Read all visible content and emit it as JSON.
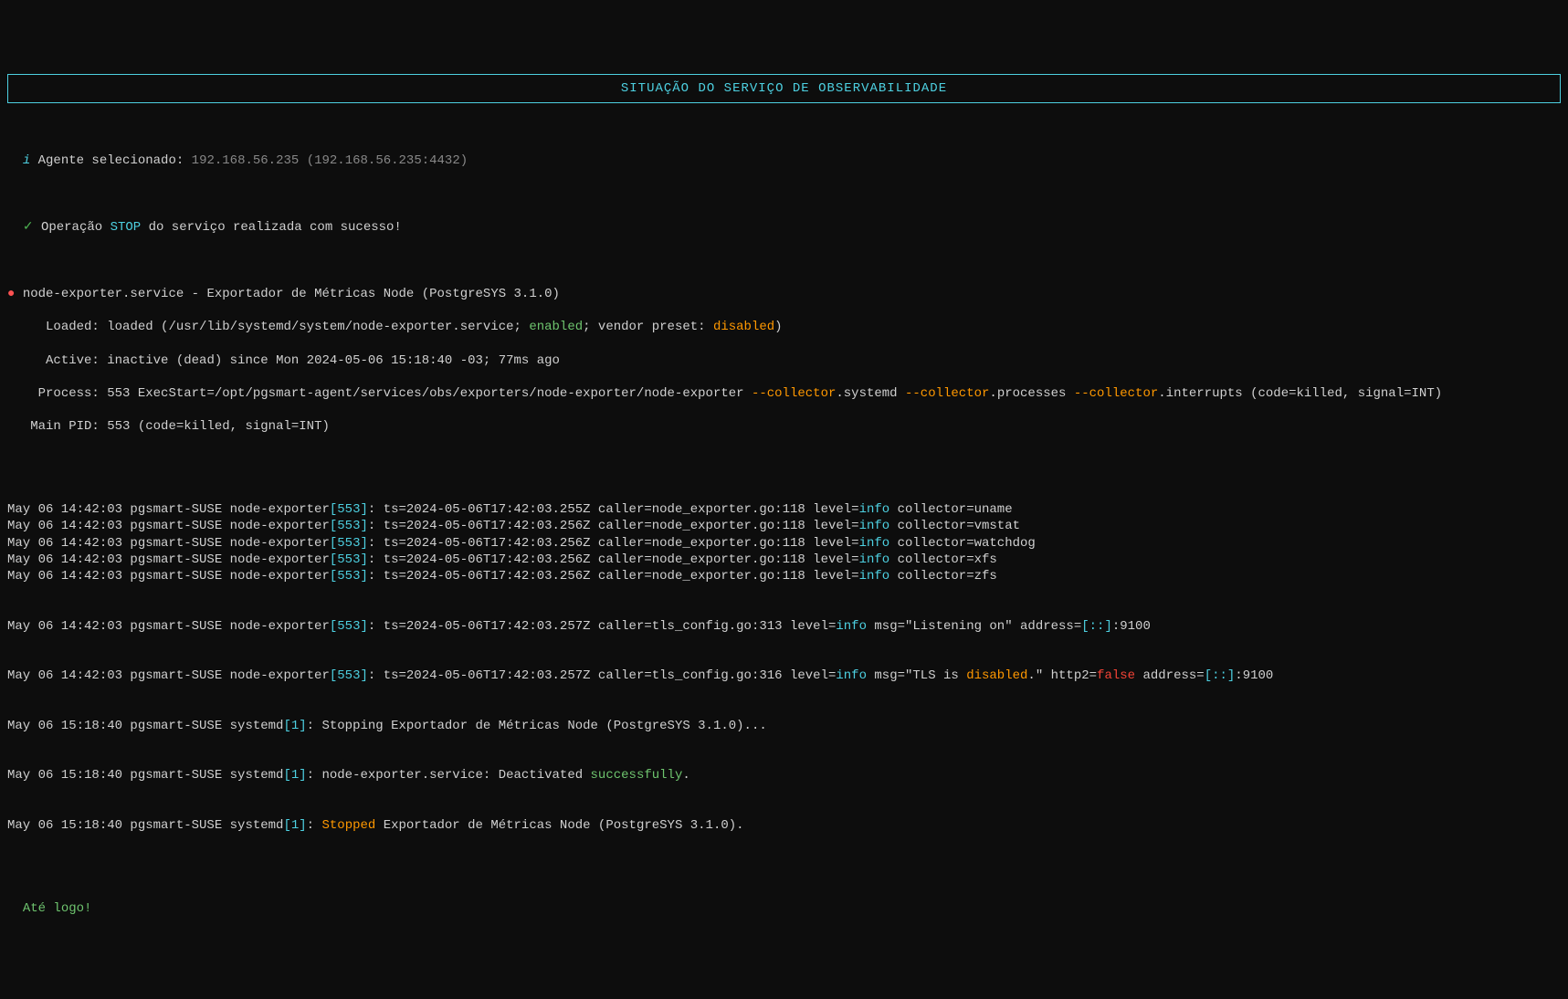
{
  "header": {
    "title": "SITUAÇÃO DO SERVIÇO DE OBSERVABILIDADE"
  },
  "agent": {
    "label": "Agente selecionado:",
    "ip": "192.168.56.235",
    "addr": "(192.168.56.235:4432)"
  },
  "operation": {
    "prefix": "Operação ",
    "action": "STOP",
    "suffix": " do serviço realizada com sucesso!"
  },
  "service": {
    "name": "node-exporter.service",
    "desc": "Exportador de Métricas Node (PostgreSYS 3.1.0)",
    "loaded_label": "Loaded:",
    "loaded_text1": "loaded (/usr/lib/systemd/system/node-exporter.service; ",
    "enabled": "enabled",
    "loaded_text2": "; vendor preset: ",
    "disabled_preset": "disabled",
    "loaded_text3": ")",
    "active_label": "Active:",
    "active_text": "inactive (dead) since Mon 2024-05-06 15:18:40 -03; 77ms ago",
    "process_label": "Process:",
    "process_text1": "553 ExecStart=/opt/pgsmart-agent/services/obs/exporters/node-exporter/node-exporter ",
    "collector_flag1": "--collector",
    "collector_val1": ".systemd ",
    "collector_flag2": "--collector",
    "collector_val2": ".processes ",
    "collector_flag3": "--collector",
    "collector_val3": ".interrupts (code=killed, signal=INT)",
    "mainpid_label": "Main PID:",
    "mainpid_text": "553 (code=killed, signal=INT)"
  },
  "logs": [
    {
      "ts": "May 06 14:42:03 pgsmart-SUSE node-exporter",
      "pid": "553",
      "body1": ": ts=2024-05-06T17:42:03.255Z caller=node_exporter.go:118 level=",
      "level": "info",
      "body2": " collector=uname"
    },
    {
      "ts": "May 06 14:42:03 pgsmart-SUSE node-exporter",
      "pid": "553",
      "body1": ": ts=2024-05-06T17:42:03.256Z caller=node_exporter.go:118 level=",
      "level": "info",
      "body2": " collector=vmstat"
    },
    {
      "ts": "May 06 14:42:03 pgsmart-SUSE node-exporter",
      "pid": "553",
      "body1": ": ts=2024-05-06T17:42:03.256Z caller=node_exporter.go:118 level=",
      "level": "info",
      "body2": " collector=watchdog"
    },
    {
      "ts": "May 06 14:42:03 pgsmart-SUSE node-exporter",
      "pid": "553",
      "body1": ": ts=2024-05-06T17:42:03.256Z caller=node_exporter.go:118 level=",
      "level": "info",
      "body2": " collector=xfs"
    },
    {
      "ts": "May 06 14:42:03 pgsmart-SUSE node-exporter",
      "pid": "553",
      "body1": ": ts=2024-05-06T17:42:03.256Z caller=node_exporter.go:118 level=",
      "level": "info",
      "body2": " collector=zfs"
    }
  ],
  "log_listen": {
    "ts": "May 06 14:42:03 pgsmart-SUSE node-exporter",
    "pid": "553",
    "body1": ": ts=2024-05-06T17:42:03.257Z caller=tls_config.go:313 level=",
    "level": "info",
    "body2": " msg=\"Listening on\" address=",
    "addr": "[::]",
    "port": ":9100"
  },
  "log_tls": {
    "ts": "May 06 14:42:03 pgsmart-SUSE node-exporter",
    "pid": "553",
    "body1": ": ts=2024-05-06T17:42:03.257Z caller=tls_config.go:316 level=",
    "level": "info",
    "body2": " msg=\"TLS is ",
    "disabled": "disabled",
    "body3": ".\" http2=",
    "false": "false",
    "body4": " address=",
    "addr": "[::]",
    "port": ":9100"
  },
  "log_stop": {
    "ts": "May 06 15:18:40 pgsmart-SUSE systemd",
    "pid": "1",
    "body": ": Stopping Exportador de Métricas Node (PostgreSYS 3.1.0)..."
  },
  "log_deact": {
    "ts": "May 06 15:18:40 pgsmart-SUSE systemd",
    "pid": "1",
    "body1": ": node-exporter.service: Deactivated ",
    "success": "successfully",
    "body2": "."
  },
  "log_stopped": {
    "ts": "May 06 15:18:40 pgsmart-SUSE systemd",
    "pid": "1",
    "body1": ": ",
    "stopped": "Stopped",
    "body2": " Exportador de Métricas Node (PostgreSYS 3.1.0)."
  },
  "footer": "Até logo!"
}
